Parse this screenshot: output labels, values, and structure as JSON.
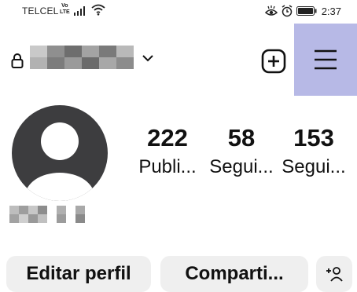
{
  "status_bar": {
    "carrier": "TELCEL",
    "volte_top": "Vo",
    "volte_bottom": "LTE",
    "time": "2:37"
  },
  "header": {
    "lock_icon": "lock-icon",
    "dropdown_icon": "chevron-down-icon",
    "create_icon": "plus-square-icon",
    "menu_icon": "hamburger-menu-icon",
    "menu_highlight_color": "#b7b9e6"
  },
  "profile": {
    "avatar_icon": "default-avatar-icon",
    "stats": [
      {
        "value": "222",
        "label": "Publi..."
      },
      {
        "value": "58",
        "label": "Segui..."
      },
      {
        "value": "153",
        "label": "Segui..."
      }
    ]
  },
  "actions": {
    "edit_label": "Editar perfil",
    "share_label": "Comparti...",
    "add_icon": "add-person-icon",
    "button_bg": "#efefef"
  }
}
